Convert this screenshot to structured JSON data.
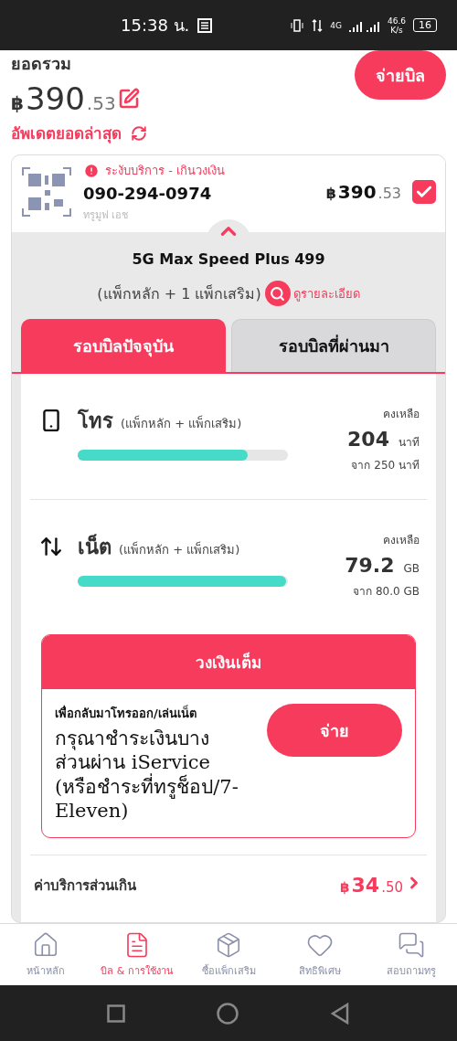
{
  "status_bar": {
    "time": "15:38 น.",
    "network": "4G",
    "speed": "46.6",
    "speed_unit": "K/s",
    "battery": "16"
  },
  "summary": {
    "title": "ยอดรวม",
    "currency": "฿",
    "amount": "390",
    "decimals": ".53",
    "pay_button": "จ่ายบิล",
    "refresh": "อัพเดตยอดล่าสุด"
  },
  "account": {
    "status": "ระงับบริการ - เกินวงเงิน",
    "number": "090-294-0974",
    "operator": "ทรูมูฟ เอช",
    "currency": "฿",
    "amount": "390",
    "decimals": ".53",
    "checked": true,
    "expanded": true
  },
  "package": {
    "name": "5G Max Speed Plus 499",
    "subtitle": "(แพ็กหลัก + 1 แพ็กเสริม)",
    "details_link": "ดูรายละเอียด"
  },
  "tabs": [
    {
      "label": "รอบบิลปัจจุบัน",
      "selected": true
    },
    {
      "label": "รอบบิลที่ผ่านมา",
      "selected": false
    }
  ],
  "usage": [
    {
      "kind": "call",
      "title": "โทร",
      "note": "(แพ็กหลัก + แพ็กเสริม)",
      "remaining_label": "คงเหลือ",
      "value": "204",
      "unit": "นาที",
      "total": "จาก 250 นาที",
      "level": 0.81
    },
    {
      "kind": "data",
      "title": "เน็ต",
      "note": "(แพ็กหลัก + แพ็กเสริม)",
      "remaining_label": "คงเหลือ",
      "value": "79.2",
      "unit": "GB",
      "total": "จาก 80.0 GB",
      "level": 0.99
    }
  ],
  "credit_alert": {
    "header": "วงเงินเต็ม",
    "heading": "เพื่อกลับมาโทรออก/เล่นเน็ต",
    "message": "กรุณาชำระเงินบางส่วนผ่าน iService (หรือชำระที่ทรูช็อป/7-Eleven)",
    "button": "จ่าย"
  },
  "overage": {
    "label": "ค่าบริการส่วนเกิน",
    "currency": "฿",
    "amount": "34",
    "decimals": ".50"
  },
  "bottom_nav": [
    {
      "kind": "home",
      "label": "หน้าหลัก",
      "selected": false
    },
    {
      "kind": "bill",
      "label": "บิล & การใช้งาน",
      "selected": true
    },
    {
      "kind": "addon",
      "label": "ซื้อแพ็กเสริม",
      "selected": false
    },
    {
      "kind": "privilege",
      "label": "สิทธิพิเศษ",
      "selected": false
    },
    {
      "kind": "help",
      "label": "สอบถามทรู",
      "selected": false
    }
  ]
}
